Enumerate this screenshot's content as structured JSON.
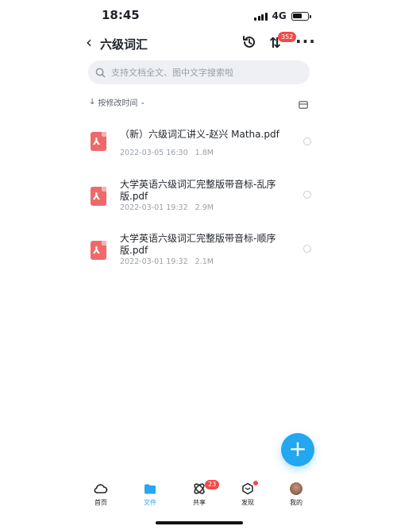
{
  "status_bar": {
    "time": "18:45",
    "network": "4G"
  },
  "header": {
    "back_icon": "chevron-left-icon",
    "title": "六级词汇",
    "sort_badge": "352"
  },
  "search": {
    "placeholder": "支持文档全文、图中文字搜索啦"
  },
  "sort": {
    "label": "按修改时间"
  },
  "files": [
    {
      "name": "（新）六级词汇讲义-赵兴 Matha.pdf",
      "date": "2022-03-05 16:30",
      "size": "1.8M"
    },
    {
      "name": "大学英语六级词汇完整版带音标-乱序版.pdf",
      "date": "2022-03-01 19:32",
      "size": "2.9M"
    },
    {
      "name": "大学英语六级词汇完整版带音标-顺序版.pdf",
      "date": "2022-03-01 19:32",
      "size": "2.1M"
    }
  ],
  "fab": {
    "label": "+"
  },
  "tabbar": {
    "items": [
      {
        "label": "首页",
        "icon": "cloud-icon"
      },
      {
        "label": "文件",
        "icon": "folder-icon"
      },
      {
        "label": "共享",
        "icon": "share-icon"
      },
      {
        "label": "发现",
        "icon": "discover-icon"
      },
      {
        "label": "我的",
        "icon": "avatar"
      }
    ],
    "share_badge": "23",
    "accent_color": "#2aa5f2"
  }
}
